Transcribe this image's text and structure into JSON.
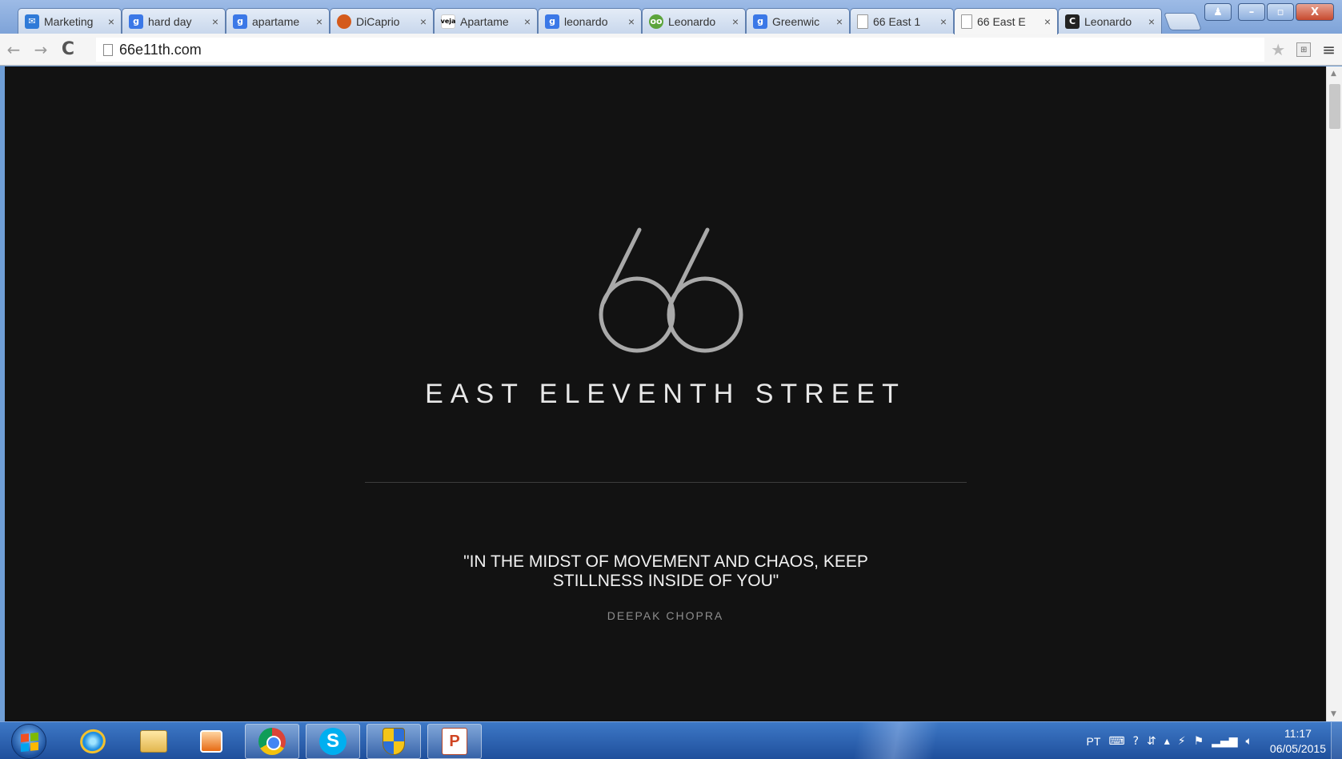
{
  "tabs": [
    {
      "title": "Marketing",
      "favicon": "mail-icon",
      "active": false
    },
    {
      "title": "hard day",
      "favicon": "google-icon",
      "active": false
    },
    {
      "title": "apartame",
      "favicon": "google-icon",
      "active": false
    },
    {
      "title": "DiCaprio",
      "favicon": "dicaprio-site-icon",
      "active": false
    },
    {
      "title": "Apartame",
      "favicon": "veja-icon",
      "active": false
    },
    {
      "title": "leonardo",
      "favicon": "google-icon",
      "active": false
    },
    {
      "title": "Leonardo",
      "favicon": "owl-icon",
      "active": false
    },
    {
      "title": "Greenwic",
      "favicon": "google-icon",
      "active": false
    },
    {
      "title": "66 East 1",
      "favicon": "page-icon",
      "active": false
    },
    {
      "title": "66 East E",
      "favicon": "page-icon",
      "active": true
    },
    {
      "title": "Leonardo",
      "favicon": "curbed-icon",
      "active": false
    }
  ],
  "tab_close_glyph": "×",
  "veja_label": "veja",
  "window_controls": {
    "minimize": "–",
    "maximize": "▫",
    "close": "X"
  },
  "toolbar": {
    "back_glyph": "←",
    "forward_glyph": "→",
    "reload_glyph": "C",
    "url": "66e11th.com",
    "star_glyph": "★",
    "menu_glyph": "≡"
  },
  "page": {
    "brand_name": "EAST ELEVENTH STREET",
    "quote_line1": "\"IN THE MIDST OF MOVEMENT AND CHAOS, KEEP",
    "quote_line2": "STILLNESS INSIDE OF YOU\"",
    "author": "DEEPAK CHOPRA",
    "background_color": "#121212",
    "logo_color": "#a9a9a9"
  },
  "taskbar": {
    "skype_label": "S",
    "ppt_label": "P",
    "language": "PT",
    "time": "11:17",
    "date": "06/05/2015"
  }
}
